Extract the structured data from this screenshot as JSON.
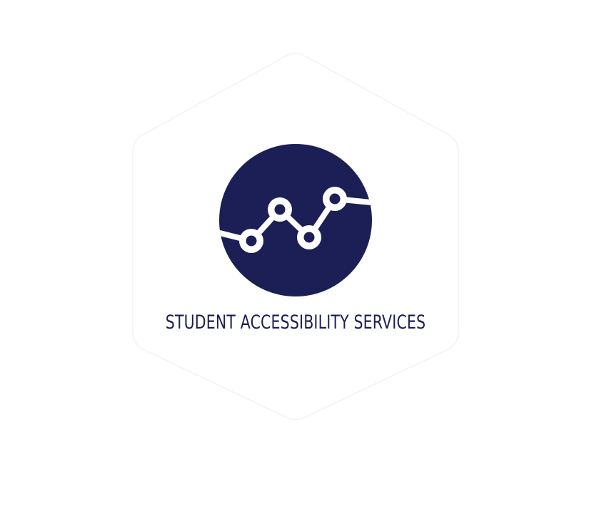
{
  "logo": {
    "title": "STUDENT ACCESSIBILITY SERVICES",
    "brand_color": "#1b1f55",
    "background_color": "#ffffff",
    "hexagon_outline_color": "#f2f2f2",
    "emblem_icon": "line-chart-nodes-icon"
  }
}
